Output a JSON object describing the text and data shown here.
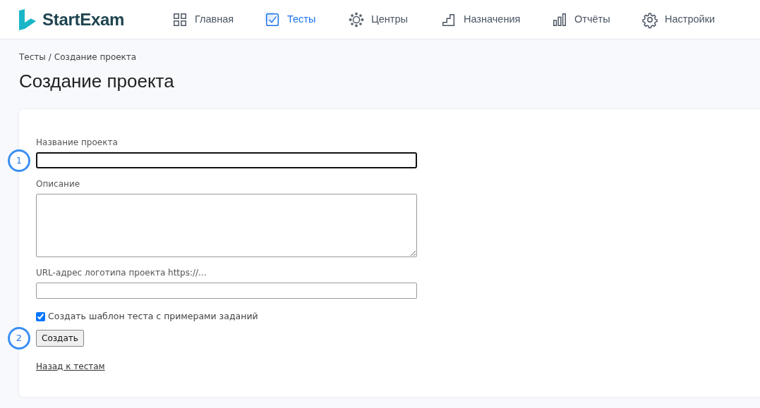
{
  "logo": {
    "text": "StartExam"
  },
  "nav": [
    {
      "label": "Главная",
      "selected": false
    },
    {
      "label": "Тесты",
      "selected": true
    },
    {
      "label": "Центры",
      "selected": false
    },
    {
      "label": "Назначения",
      "selected": false
    },
    {
      "label": "Отчёты",
      "selected": false
    },
    {
      "label": "Настройки",
      "selected": false
    }
  ],
  "breadcrumb": [
    "Тесты",
    "Создание проекта"
  ],
  "breadcrumb_separator": "/",
  "heading": "Создание проекта",
  "form": {
    "fields": [
      {
        "kind": "input",
        "label": "Название проекта",
        "focused": true,
        "callout": "1"
      },
      {
        "kind": "textarea",
        "label": "Описание",
        "focused": false
      },
      {
        "kind": "input",
        "label": "URL-адрес логотипа проекта https://...",
        "focused": false
      }
    ],
    "checkbox": {
      "label": "Создать шаблон теста с примерами заданий",
      "checked": true
    },
    "submit": {
      "label": "Создать",
      "callout": "2"
    },
    "back_link": "Назад к тестам"
  }
}
